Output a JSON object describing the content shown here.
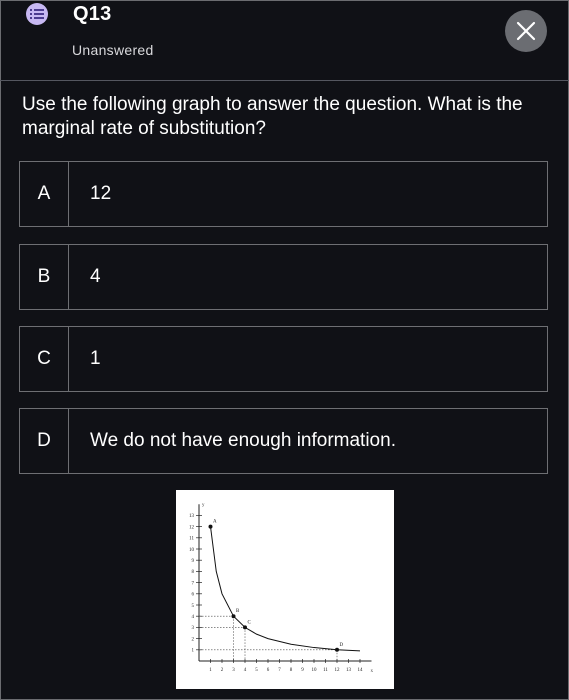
{
  "header": {
    "question_number": "Q13",
    "status": "Unanswered"
  },
  "question": {
    "text": "Use the following graph to answer the question. What is the marginal rate of substitution?"
  },
  "options": [
    {
      "letter": "A",
      "text": "12"
    },
    {
      "letter": "B",
      "text": "4"
    },
    {
      "letter": "C",
      "text": "1"
    },
    {
      "letter": "D",
      "text": "We do not have enough information."
    }
  ],
  "colors": {
    "background": "#101116",
    "border": "#6e6f73",
    "icon_badge": "#c7b8f2",
    "close_button": "#6b6d72"
  },
  "icons": {
    "question_type": "list-icon",
    "close": "close-icon"
  },
  "chart_data": {
    "type": "line",
    "x_axis_label": "x",
    "y_axis_label": "y",
    "xlim": [
      0,
      15
    ],
    "ylim": [
      0,
      14
    ],
    "x_ticks": [
      "1",
      "2",
      "3",
      "4",
      "5",
      "6",
      "7",
      "8",
      "9",
      "10",
      "11",
      "12",
      "13",
      "14"
    ],
    "y_ticks": [
      "1",
      "2",
      "3",
      "4",
      "5",
      "6",
      "7",
      "8",
      "9",
      "10",
      "11",
      "12",
      "13"
    ],
    "curve": {
      "x": [
        1,
        1.5,
        2,
        3,
        4,
        5,
        6,
        8,
        10,
        12,
        14
      ],
      "y": [
        12,
        8,
        6,
        4,
        3,
        2.4,
        2,
        1.5,
        1.2,
        1,
        0.9
      ]
    },
    "points": [
      {
        "label": "A",
        "x": 1,
        "y": 12
      },
      {
        "label": "B",
        "x": 3,
        "y": 4
      },
      {
        "label": "C",
        "x": 4,
        "y": 3
      },
      {
        "label": "D",
        "x": 12,
        "y": 1
      }
    ]
  }
}
